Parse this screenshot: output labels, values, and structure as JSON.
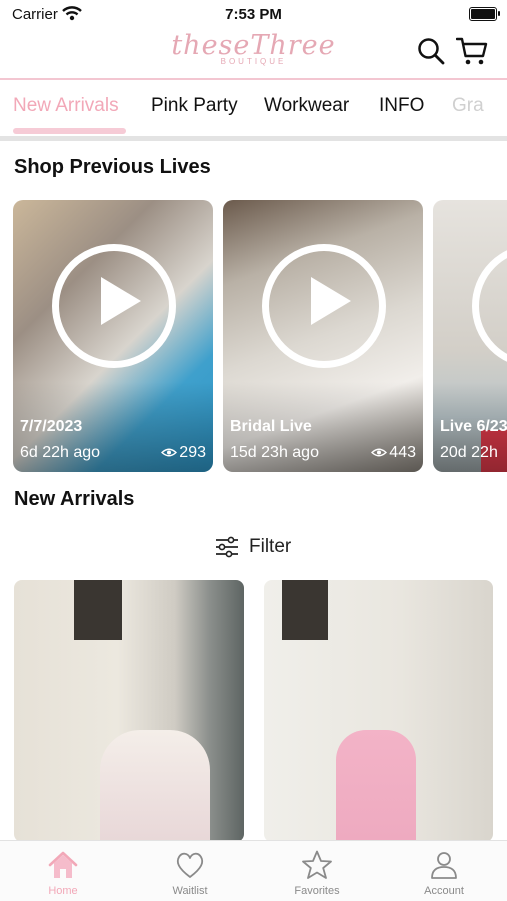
{
  "status_bar": {
    "carrier": "Carrier",
    "time": "7:53 PM"
  },
  "header": {
    "logo_text": "theseThree",
    "logo_subtext": "BOUTIQUE"
  },
  "tabs": [
    {
      "label": "New Arrivals",
      "active": true
    },
    {
      "label": "Pink Party"
    },
    {
      "label": "Workwear"
    },
    {
      "label": "INFO"
    },
    {
      "label": "Gra"
    }
  ],
  "lives_section": {
    "title": "Shop Previous Lives",
    "items": [
      {
        "title": "7/7/2023",
        "ago": "6d 22h ago",
        "views": "293"
      },
      {
        "title": "Bridal Live",
        "ago": "15d 23h ago",
        "views": "443"
      },
      {
        "title": "Live 6/23",
        "ago": "20d 22h"
      }
    ]
  },
  "new_arrivals": {
    "title": "New Arrivals",
    "filter_label": "Filter"
  },
  "bottom_nav": [
    {
      "label": "Home",
      "icon": "home-icon",
      "active": true
    },
    {
      "label": "Waitlist",
      "icon": "heart-icon"
    },
    {
      "label": "Favorites",
      "icon": "star-icon"
    },
    {
      "label": "Account",
      "icon": "person-icon"
    }
  ],
  "colors": {
    "accent_pink": "#f2a8b8",
    "logo_pink": "#e5a8b4"
  }
}
